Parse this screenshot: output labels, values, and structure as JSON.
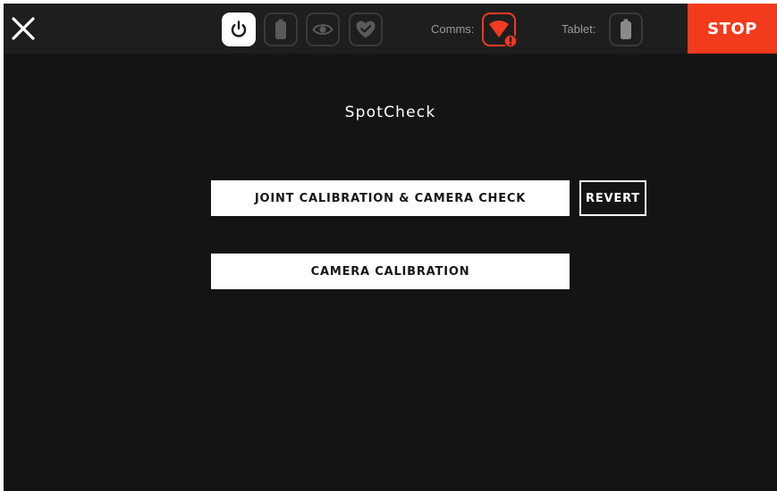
{
  "topbar": {
    "status_icons": [
      {
        "icon": "power-icon",
        "state": "active"
      },
      {
        "icon": "battery-icon",
        "state": "inactive"
      },
      {
        "icon": "eye-icon",
        "state": "inactive"
      },
      {
        "icon": "heart-icon",
        "state": "inactive"
      }
    ],
    "comms_label": "Comms:",
    "comms_icon": "wifi-warning-icon",
    "tablet_label": "Tablet:",
    "tablet_icon": "battery-icon",
    "stop_label": "STOP"
  },
  "main": {
    "title": "SpotCheck",
    "buttons": {
      "joint_calibration": "JOINT CALIBRATION & CAMERA CHECK",
      "revert": "REVERT",
      "camera_calibration": "CAMERA CALIBRATION"
    }
  },
  "colors": {
    "background": "#141414",
    "topbar": "#1e1e1e",
    "accent_red": "#f23b1d",
    "inactive_border": "#3a3a3a",
    "label_gray": "#9a9a9a"
  }
}
